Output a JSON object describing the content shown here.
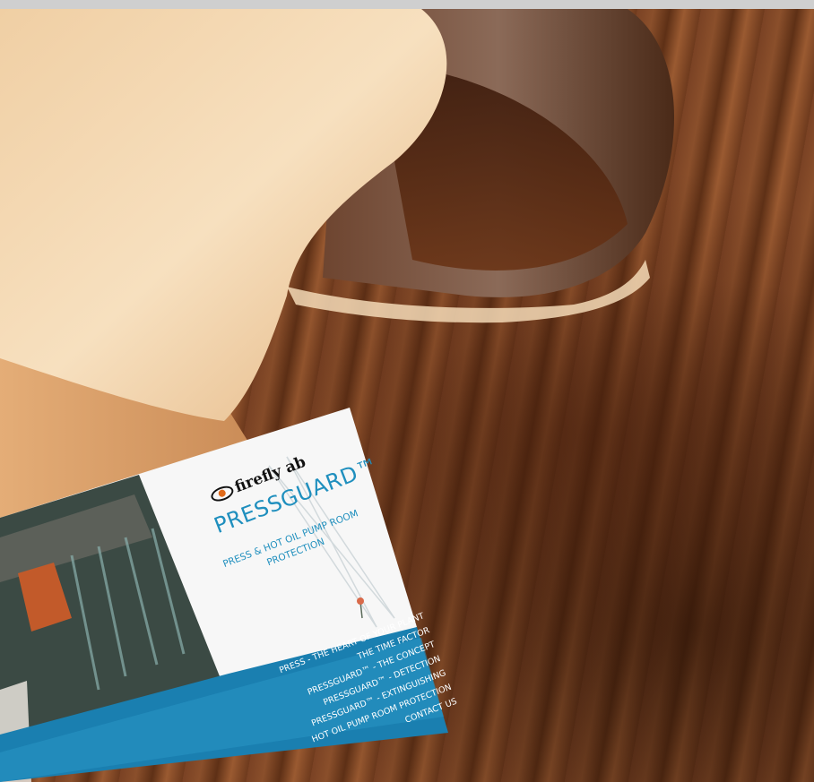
{
  "brochure": {
    "logo_text": "firefly ab",
    "title": "PRESSGUARD™",
    "subtitle_line1": "PRESS & HOT OIL PUMP ROOM",
    "subtitle_line2": "PROTECTION",
    "menu": [
      "PRESS - THE HEART OF YOUR PLANT",
      "THE TIME FACTOR",
      "PRESSGUARD™ - THE CONCEPT",
      "PRESSGUARD™ - DETECTION",
      "PRESSGUARD™ - EXTINGUISHING",
      "HOT OIL PUMP ROOM PROTECTION",
      "CONTACT US"
    ]
  },
  "colors": {
    "brand_blue": "#1f8fbe",
    "band_blue": "#1a7fb0",
    "wood_dark": "#5e3016",
    "veneer_light": "#f2d3aa"
  }
}
